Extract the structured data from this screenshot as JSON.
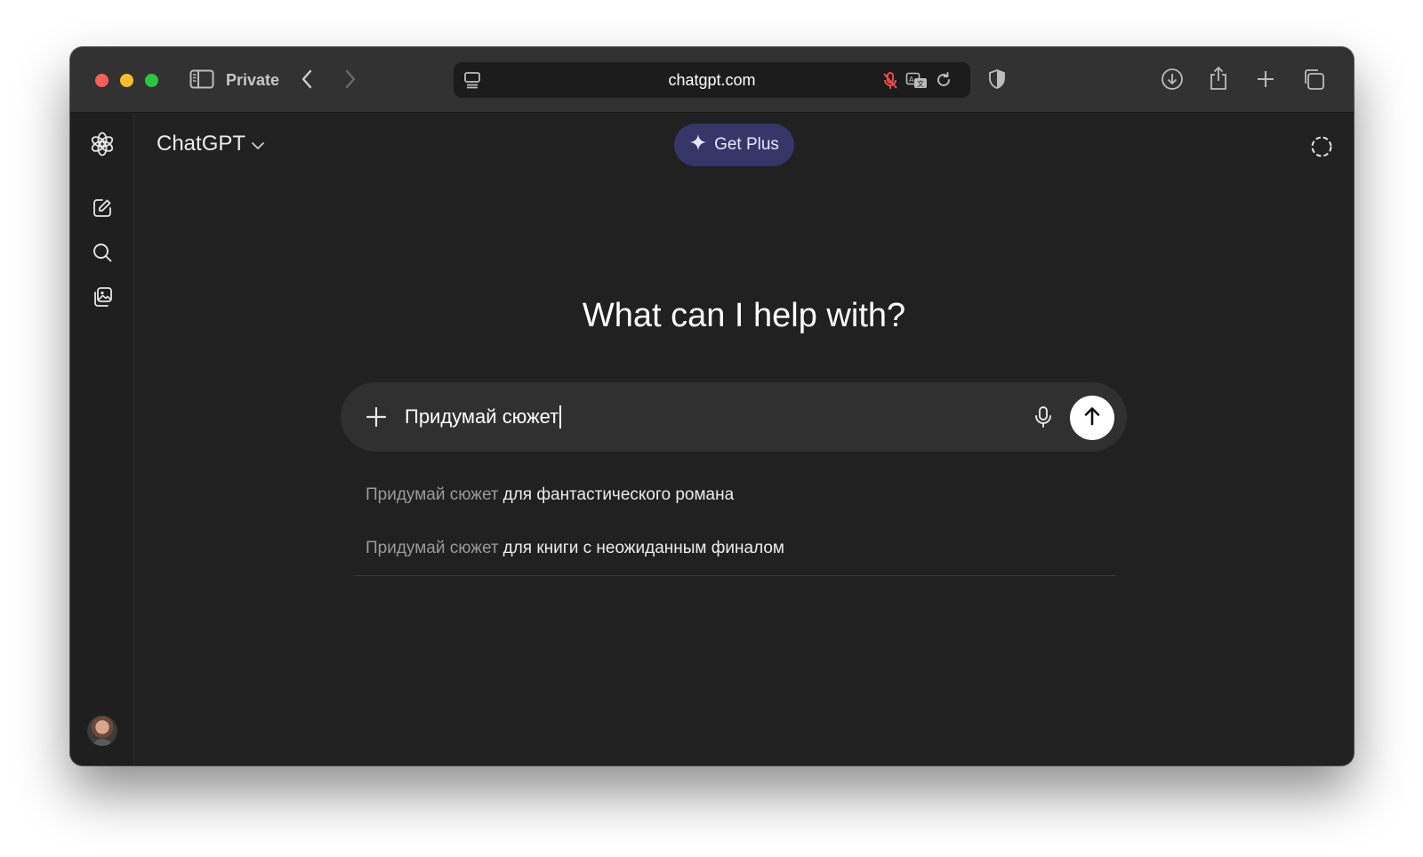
{
  "browser": {
    "tab_mode_label": "Private",
    "url": "chatgpt.com"
  },
  "header": {
    "model_name": "ChatGPT",
    "upgrade_label": "Get Plus"
  },
  "main": {
    "headline": "What can I help with?",
    "composer": {
      "value": "Придумай сюжет"
    },
    "suggestions": [
      {
        "typed": "Придумай сюжет",
        "completion": "для фантастического романа"
      },
      {
        "typed": "Придумай сюжет",
        "completion": "для книги с неожиданным финалом"
      }
    ]
  },
  "colors": {
    "window_bg": "#212121",
    "sidebar_bg": "#1f1f1f",
    "toolbar_bg": "#323232",
    "get_plus_bg": "#373669",
    "composer_bg": "#303030"
  }
}
